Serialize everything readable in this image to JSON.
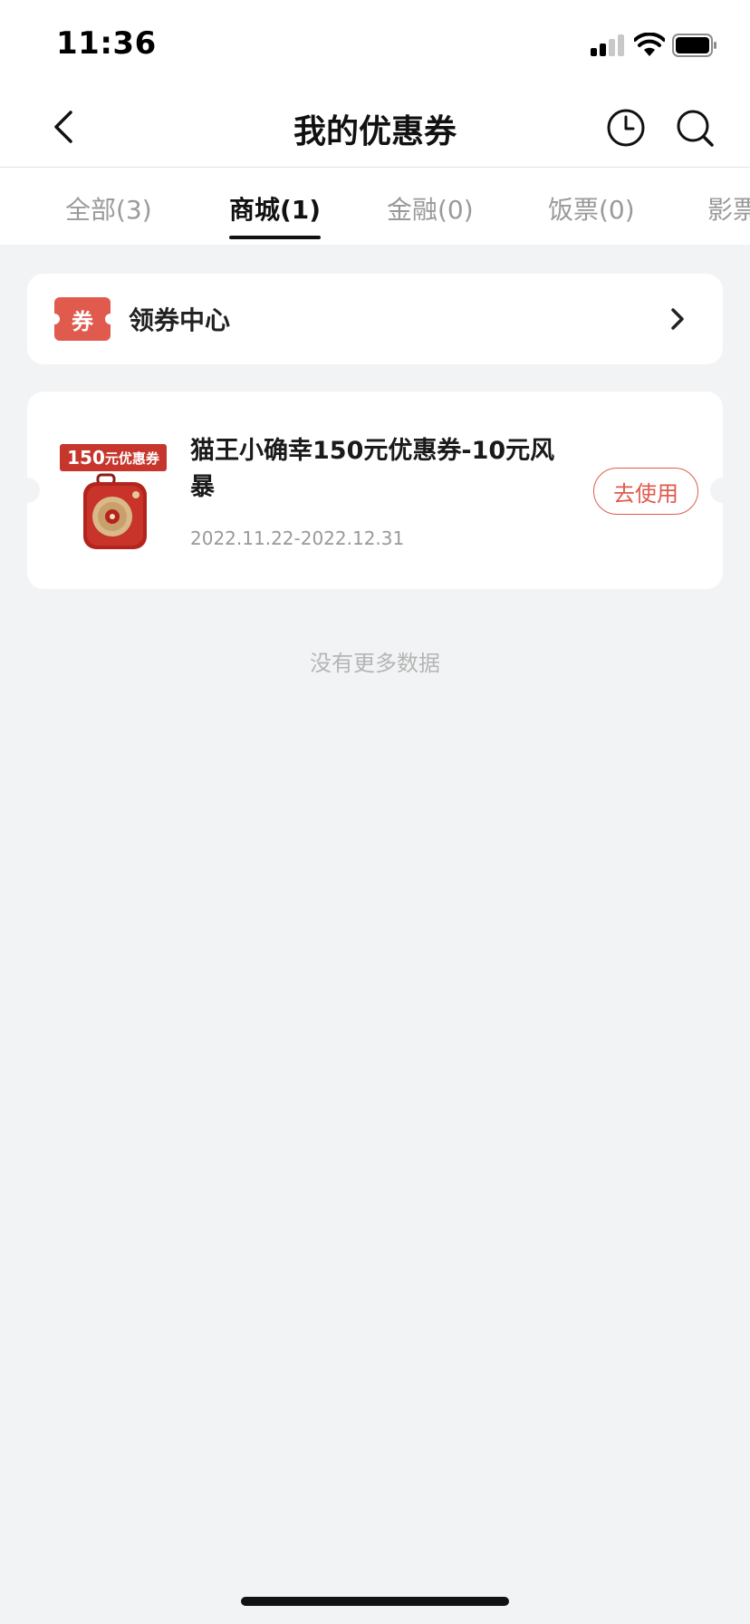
{
  "status_bar": {
    "time": "11:36"
  },
  "nav": {
    "title": "我的优惠券"
  },
  "tabs": [
    {
      "label": "全部(3)",
      "active": false
    },
    {
      "label": "商城(1)",
      "active": true
    },
    {
      "label": "金融(0)",
      "active": false
    },
    {
      "label": "饭票(0)",
      "active": false
    },
    {
      "label": "影票",
      "active": false
    }
  ],
  "coupon_center": {
    "badge": "券",
    "label": "领券中心"
  },
  "coupons": [
    {
      "amount_tag_value": "150",
      "amount_tag_label": "元优惠券",
      "title": "猫王小确幸150元优惠券-10元风暴",
      "date_range": "2022.11.22-2022.12.31",
      "action_label": "去使用"
    }
  ],
  "footer": {
    "no_more": "没有更多数据"
  },
  "colors": {
    "accent": "#e05a4e",
    "tag": "#c7362d",
    "background": "#f2f3f5"
  }
}
